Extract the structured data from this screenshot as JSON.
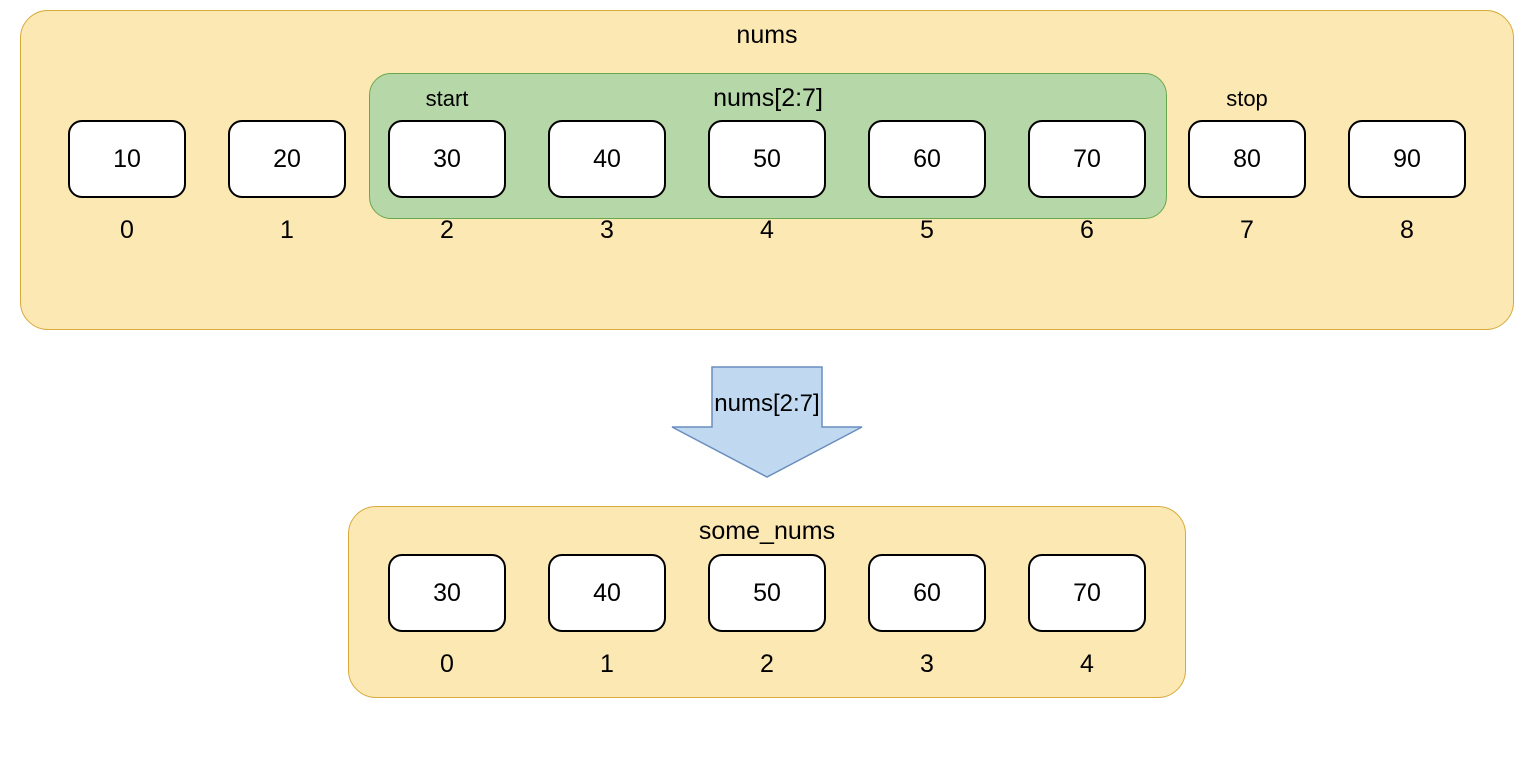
{
  "top": {
    "title": "nums",
    "slice_label": "nums[2:7]",
    "start_label": "start",
    "stop_label": "stop",
    "cells": [
      {
        "value": "10",
        "index": "0"
      },
      {
        "value": "20",
        "index": "1"
      },
      {
        "value": "30",
        "index": "2"
      },
      {
        "value": "40",
        "index": "3"
      },
      {
        "value": "50",
        "index": "4"
      },
      {
        "value": "60",
        "index": "5"
      },
      {
        "value": "70",
        "index": "6"
      },
      {
        "value": "80",
        "index": "7"
      },
      {
        "value": "90",
        "index": "8"
      }
    ],
    "slice_start_index": 2,
    "slice_end_index": 6,
    "stop_index": 7
  },
  "arrow": {
    "label": "nums[2:7]"
  },
  "bottom": {
    "title": "some_nums",
    "cells": [
      {
        "value": "30",
        "index": "0"
      },
      {
        "value": "40",
        "index": "1"
      },
      {
        "value": "50",
        "index": "2"
      },
      {
        "value": "60",
        "index": "3"
      },
      {
        "value": "70",
        "index": "4"
      }
    ]
  },
  "colors": {
    "yellow_fill": "#fce8b2",
    "yellow_border": "#d8a93b",
    "green_fill": "#b6d7a8",
    "green_border": "#6aa84f",
    "arrow_fill": "#c1d9f0",
    "arrow_border": "#6a8ebf"
  }
}
